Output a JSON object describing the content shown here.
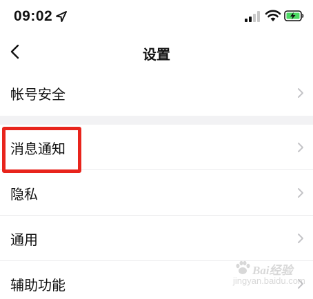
{
  "status_bar": {
    "time": "09:02",
    "icons": [
      "location-arrow-icon",
      "cellular-signal-icon",
      "wifi-icon",
      "battery-charging-icon"
    ],
    "battery_color": "#4cd964"
  },
  "nav": {
    "back_icon": "chevron-left-icon",
    "title": "设置"
  },
  "groups": [
    {
      "items": [
        {
          "label": "帐号安全"
        }
      ]
    },
    {
      "items": [
        {
          "label": "消息通知",
          "highlighted": true
        },
        {
          "label": "隐私"
        },
        {
          "label": "通用"
        },
        {
          "label": "辅助功能"
        }
      ]
    }
  ],
  "annotation": {
    "highlight_color": "#e8241c"
  },
  "watermark": {
    "brand": "Bai经验",
    "url": "jingyan.baidu.com"
  },
  "colors": {
    "background": "#ffffff",
    "separator": "#f2f2f4",
    "chevron": "#c4c4c7",
    "text": "#111111"
  }
}
